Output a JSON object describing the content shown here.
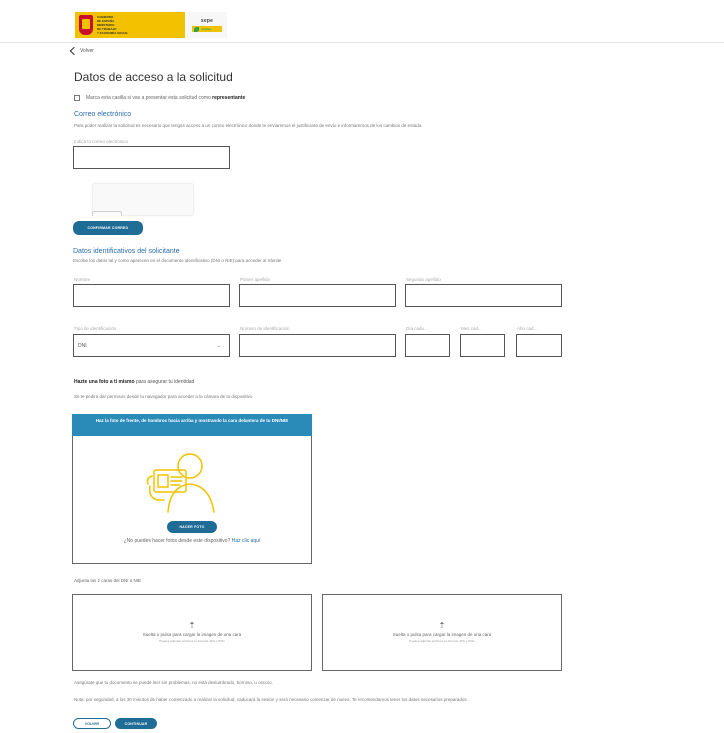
{
  "header": {
    "gov_logo_lines": [
      "GOBIERNO",
      "DE ESPAÑA",
      "MINISTERIO",
      "DE TRABAJO",
      "Y ECONOMÍA SOCIAL"
    ],
    "sepe_logo_text": "sepe",
    "sepe_sub": "empleo"
  },
  "nav": {
    "back_label": "Volver"
  },
  "page": {
    "title": "Datos de acceso a la solicitud"
  },
  "representative": {
    "label_prefix": "Marca esta casilla si vas a presentar esta solicitud como ",
    "label_bold": "representante"
  },
  "email_section": {
    "title": "Correo electrónico",
    "description": "Para poder realizar la solicitud es necesario que tengas acceso a un correo electrónico donde te enviaremos el justificante de envío e informaremos de los cambios de estado.",
    "input_label": "Indica tu correo electrónico",
    "input_value": "",
    "confirm_button": "CONFIRMAR CORREO"
  },
  "identity_section": {
    "title": "Datos identificativos del solicitante",
    "description": "Escribe los datos tal y como aparecen en el documento identificativo (DNI o NIE) para acceder al trámite",
    "fields": {
      "name": "Nombre",
      "surname1": "Primer apellido",
      "surname2": "Segundo apellido",
      "id_type": "Tipo de identificación",
      "id_type_value": "DNI",
      "id_number": "Número de identificación",
      "day": "Día cadu...",
      "month": "Mes cad...",
      "year": "Año cad..."
    }
  },
  "photo_section": {
    "title_bold": "Hazte una foto a ti mismo",
    "title_rest": " para asegurar tu identidad",
    "permission_text": "Se te pedirá dar permisos desde tu navegador para acceder a la cámara de tu dispositivo",
    "instruction": "Haz la foto de frente, de hombros hacia arriba y mostrando la cara delantera de tu DNI/NIE",
    "take_photo_button": "HACER FOTO",
    "no_camera_text": "¿No puedes hacer fotos desde este dispositivo?",
    "no_camera_link": "Haz clic aquí"
  },
  "upload_section": {
    "title": "Adjunta las 2 caras del DNI o NIE",
    "drop_text": "Suelta o pulsa para cargar la imagen de una cara",
    "drop_note": "Puedes adjuntar archivos en formato JPG o PNG",
    "readability_note": "Asegúrate que tu documento se puede leer sin problemas, no está deslumbrado, borroso, u oscuro.",
    "timeout_note": "Nota: por seguridad, a los 30 minutos de haber comenzado a realizar la solicitud, caducará la sesión y será necesario comenzar de nuevo. Te recomendamos tener los datos necesarios preparados."
  },
  "footer": {
    "back_button": "VOLVER",
    "continue_button": "CONTINUAR"
  },
  "colors": {
    "primary": "#1f6d96",
    "section_title": "#2a6ea8",
    "camera_header": "#2a8ab8",
    "illustration": "#f2c200"
  }
}
